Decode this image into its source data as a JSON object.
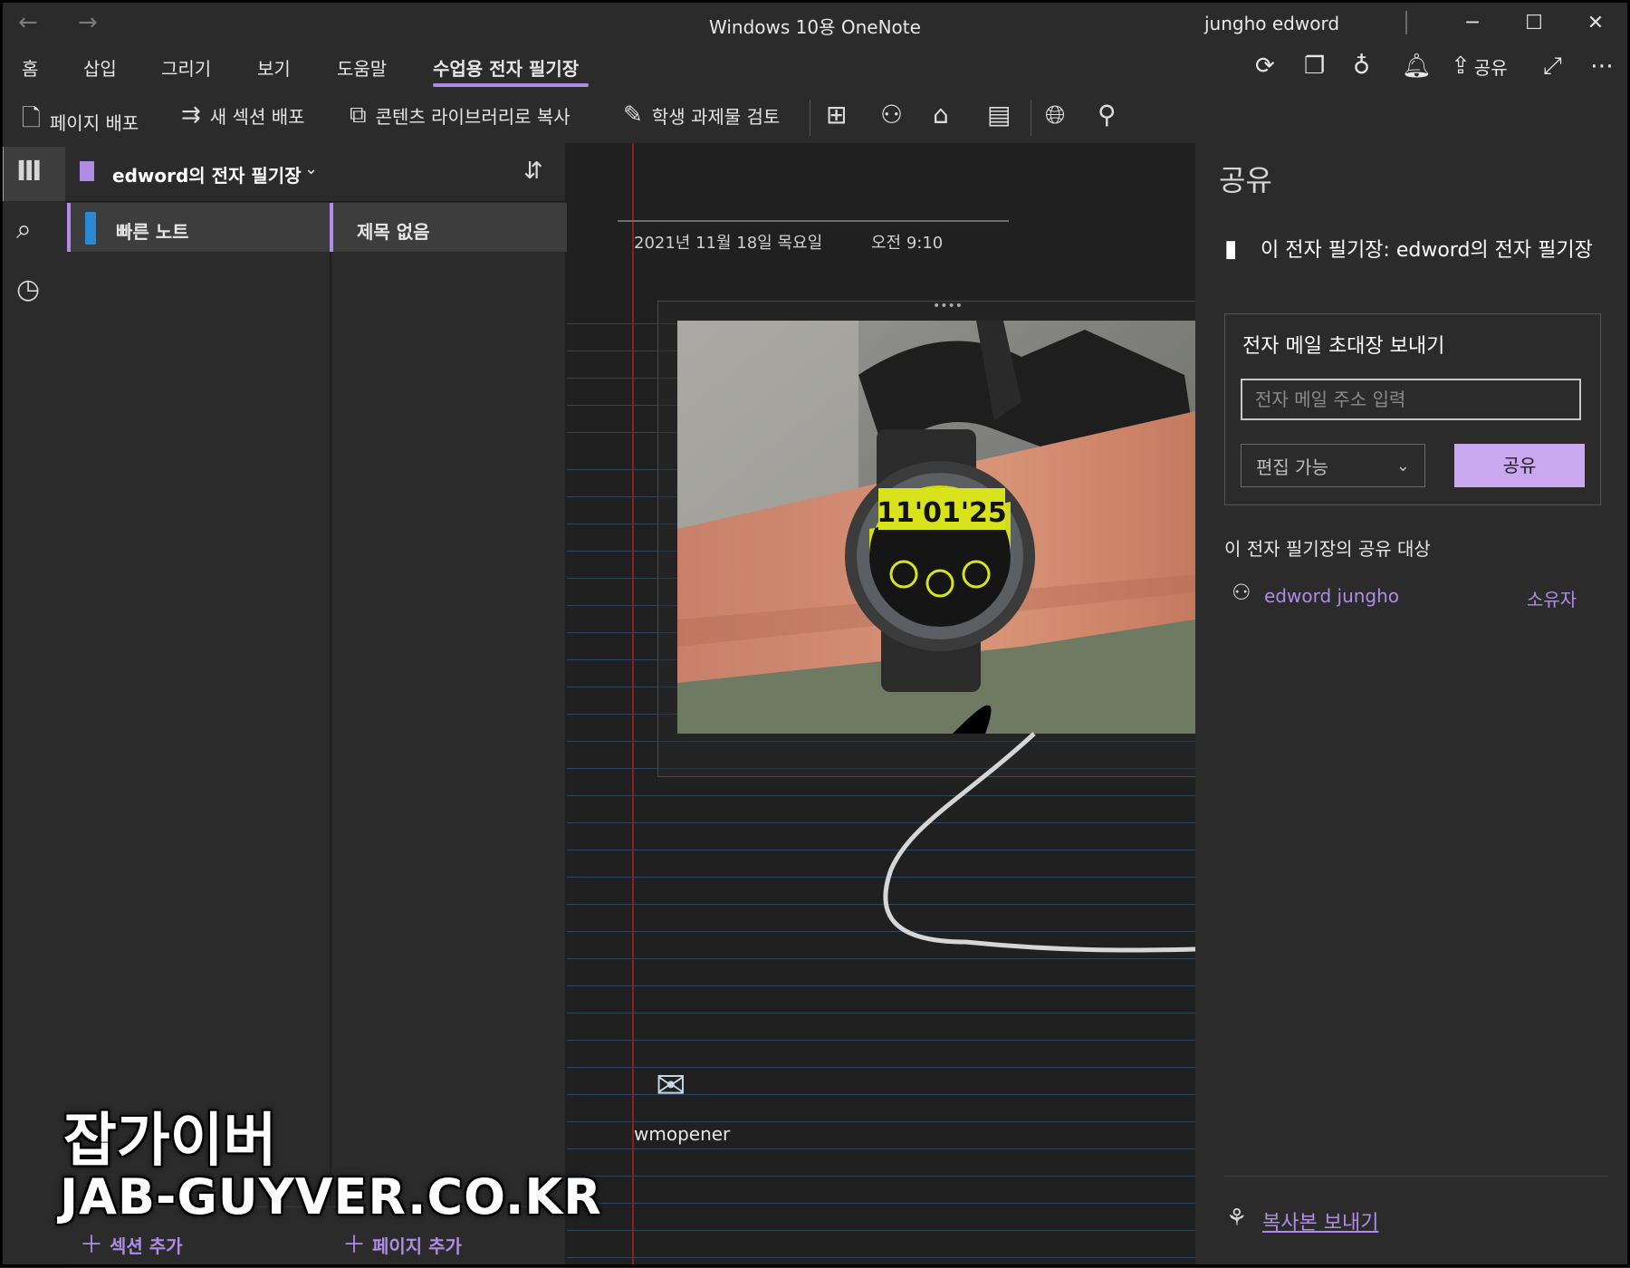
{
  "window": {
    "title": "Windows 10용 OneNote",
    "user": "jungho edword",
    "back_glyph": "←",
    "forward_glyph": "→",
    "minimize_glyph": "─",
    "maximize_glyph": "☐",
    "close_glyph": "✕"
  },
  "menu": {
    "items": [
      "홈",
      "삽입",
      "그리기",
      "보기",
      "도움말",
      "수업용 전자 필기장"
    ],
    "active": "수업용 전자 필기장",
    "share_label": "공유",
    "more_glyph": "⋯"
  },
  "ribbon": {
    "distribute_page": "페이지 배포",
    "distribute_section": "새 섹션 배포",
    "copy_to_library": "콘텐츠 라이브러리로 복사",
    "review_assignments": "학생 과제물 검토"
  },
  "notebook": {
    "name": "edword의 전자 필기장",
    "sections": [
      {
        "label": "빠른 노트",
        "color": "#2a8ad6"
      }
    ],
    "pages": [
      {
        "label": "제목 없음"
      }
    ],
    "add_section": "섹션 추가",
    "add_page": "페이지 추가"
  },
  "page": {
    "date": "2021년 11월 18일 목요일",
    "time": "오전 9:10",
    "attachment_label": "wmopener",
    "photo_watch_text": "11'01'25"
  },
  "share_panel": {
    "title": "공유",
    "notebook_line": "이 전자 필기장: edword의 전자 필기장",
    "invite_title": "전자 메일 초대장 보내기",
    "email_placeholder": "전자 메일 주소 입력",
    "permission": "편집 가능",
    "share_button": "공유",
    "shared_with_title": "이 전자 필기장의 공유 대상",
    "people": [
      {
        "name": "edword jungho",
        "role": "소유자"
      }
    ],
    "send_copy": "복사본 보내기"
  },
  "watermark": {
    "line1": "잡가이버",
    "line2": "JAB-GUYVER.CO.KR"
  },
  "colors": {
    "accent": "#b18ce6",
    "share_button_bg": "#c9a8f0",
    "section_blue": "#2a8ad6",
    "margin_red": "#8a1f1f",
    "rule_line": "#2d4663"
  }
}
